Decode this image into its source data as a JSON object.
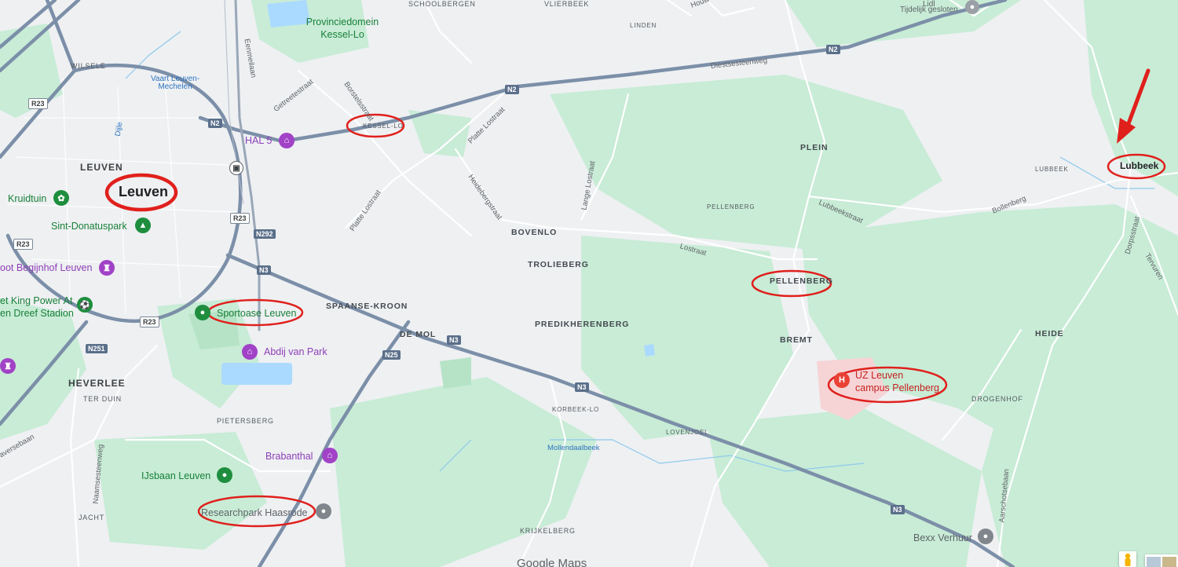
{
  "map": {
    "colors": {
      "land": "#eef0f2",
      "green": "#c8ecd6",
      "green_dark": "#b6e3c6",
      "water": "#aadaff",
      "highway": "#7c8fa8",
      "road": "#ffffff",
      "annotation": "#e0201c"
    },
    "places": {
      "schoolbergen": "SCHOOLBERGEN",
      "vlierbeek": "VLIERBEEK",
      "linden": "LINDEN",
      "wilsele": "WILSELE",
      "leuven": "LEUVEN",
      "kessel_lo": "KESSEL-LO",
      "plein": "PLEIN",
      "lubbeek": "LUBBEEK",
      "pellenberg_upper": "PELLENBERG",
      "pellenberg": "PELLENBERG",
      "bovenlo": "BOVENLO",
      "trolieberg": "TROLIEBERG",
      "spaanse_kroon": "SPAANSE-KROON",
      "predikherenberg": "PREDIKHERENBERG",
      "de_mol": "DE MOL",
      "bremt": "BREMT",
      "heide": "HEIDE",
      "heverlee": "HEVERLEE",
      "ter_duin": "TER DUIN",
      "pietersberg": "PIETERSBERG",
      "korbeek_lo": "KORBEEK-LO",
      "lovenjoel": "LOVENJOEL",
      "drogenhof": "DROGENHOF",
      "jacht": "JACHT",
      "krijkelberg": "KRIJKELBERG"
    },
    "streets": {
      "eenmeilaan": "Eenmeilaan",
      "gemeentestraat": "Getreetestraat",
      "borstelsstraat": "Borstelsstraat",
      "platte_lostraat_1": "Platte Lostraat",
      "platte_lostraat_2": "Platte Lostraat",
      "heidebergstraat": "Heidebergstraat",
      "lange_lostraat": "Lange Lostraat",
      "diestsesteenweg": "Diestsesteenweg",
      "lubbeekstraat": "Lubbeekstraat",
      "bollenberg": "Bollenberg",
      "lostraat": "Lostraat",
      "dorpsstraat": "Dorpsstraat",
      "tervuren": "Tervuren",
      "naamsesteenweg": "Naamsesteenweg",
      "aarschotsebaan": "Aarschotsebaan",
      "mollendaalbeek": "Mollendaalbeek",
      "houw": "Houw",
      "vaart": "Vaart Leuven-Mechelen",
      "dijle": "Dijle",
      "aversebaan": "aversebaan",
      "pellenberg_street": "Pellenberg"
    },
    "shields": [
      "N2",
      "N2",
      "N2",
      "R23",
      "R23",
      "R23",
      "R23",
      "N292",
      "N3",
      "N3",
      "N3",
      "N3",
      "N25",
      "N251"
    ],
    "pois": {
      "provinciedomein": "Provinciedomein Kessel-Lo",
      "tijdelijk": "Tijdelijk gesloten",
      "hal5": "HAL 5",
      "kruidtuin": "Kruidtuin",
      "sint_donatuspark": "Sint-Donatuspark",
      "begijnhof": "oot Begijnhof Leuven",
      "king_power": "et King Power At",
      "dreef_stadion": "en Dreef Stadion",
      "sportoase": "Sportoase Leuven",
      "abdij": "Abdij van Park",
      "uz_leuven_1": "UZ Leuven",
      "uz_leuven_2": "campus Pellenberg",
      "brabanthal": "Brabanthal",
      "ijsbaan": "IJsbaan Leuven",
      "researchpark": "Researchpark Haasrode",
      "bexx": "Bexx Verhuur",
      "lidl": "Lidl"
    },
    "annotations": {
      "leuven_big": "Leuven",
      "lubbeek_box": "Lubbeek"
    },
    "logo": "Google Maps",
    "icons": [
      "train-station-icon",
      "park-icon",
      "museum-icon",
      "stadium-icon",
      "hospital-icon",
      "place-icon",
      "pegman-icon",
      "layers-icon"
    ]
  }
}
